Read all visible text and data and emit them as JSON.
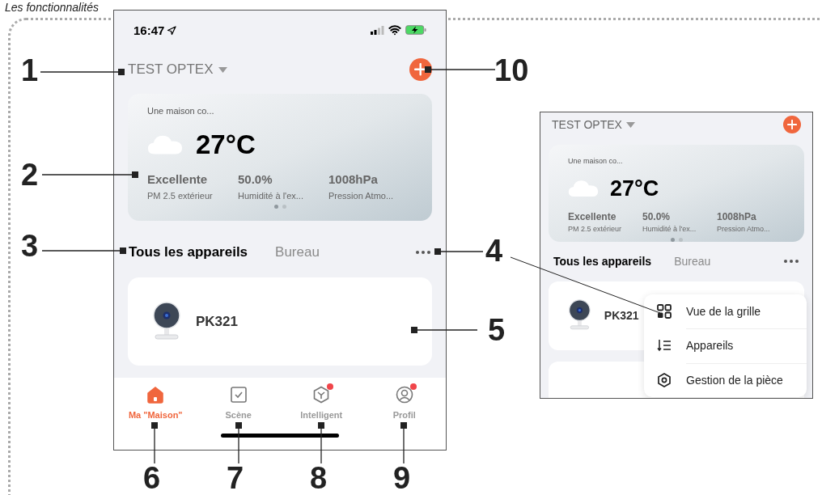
{
  "heading": "Les fonctionnalités",
  "main_screen": {
    "status_bar": {
      "time": "16:47"
    },
    "home": {
      "name": "TEST OPTEX"
    },
    "weather": {
      "location": "Une maison co...",
      "temperature": "27°C",
      "stats": [
        {
          "value": "Excellente",
          "label": "PM 2.5 extérieur"
        },
        {
          "value": "50.0%",
          "label": "Humidité à l'ex..."
        },
        {
          "value": "1008hPa",
          "label": "Pression Atmo..."
        }
      ],
      "pages": [
        {
          "selected": true
        },
        {
          "selected": false
        }
      ]
    },
    "room_tabs": [
      {
        "label": "Tous les appareils",
        "selected": true
      },
      {
        "label": "Bureau",
        "selected": false
      }
    ],
    "devices": [
      {
        "name": "PK321"
      }
    ],
    "nav": [
      {
        "label": "Ma \"Maison\"",
        "kind": "home",
        "selected": true,
        "badge": false
      },
      {
        "label": "Scène",
        "kind": "scene",
        "selected": false,
        "badge": false
      },
      {
        "label": "Intelligent",
        "kind": "smart",
        "selected": false,
        "badge": true
      },
      {
        "label": "Profil",
        "kind": "profile",
        "selected": false,
        "badge": true
      }
    ]
  },
  "inset_screen": {
    "home": {
      "name": "TEST OPTEX"
    },
    "weather": {
      "location": "Une maison co...",
      "temperature": "27°C",
      "stats": [
        {
          "value": "Excellente",
          "label": "PM 2.5 extérieur"
        },
        {
          "value": "50.0%",
          "label": "Humidité à l'ex..."
        },
        {
          "value": "1008hPa",
          "label": "Pression Atmo..."
        }
      ],
      "pages": [
        {
          "selected": true
        },
        {
          "selected": false
        }
      ]
    },
    "room_tabs": [
      {
        "label": "Tous les appareils",
        "selected": true
      },
      {
        "label": "Bureau",
        "selected": false
      }
    ],
    "devices": [
      {
        "name": "PK321"
      }
    ],
    "menu": [
      {
        "label": "Vue de la grille",
        "kind": "grid"
      },
      {
        "label": "Appareils",
        "kind": "list"
      },
      {
        "label": "Gestion de la pièce",
        "kind": "room"
      }
    ]
  },
  "callouts": [
    "1",
    "2",
    "3",
    "4",
    "5",
    "6",
    "7",
    "8",
    "9",
    "10"
  ]
}
